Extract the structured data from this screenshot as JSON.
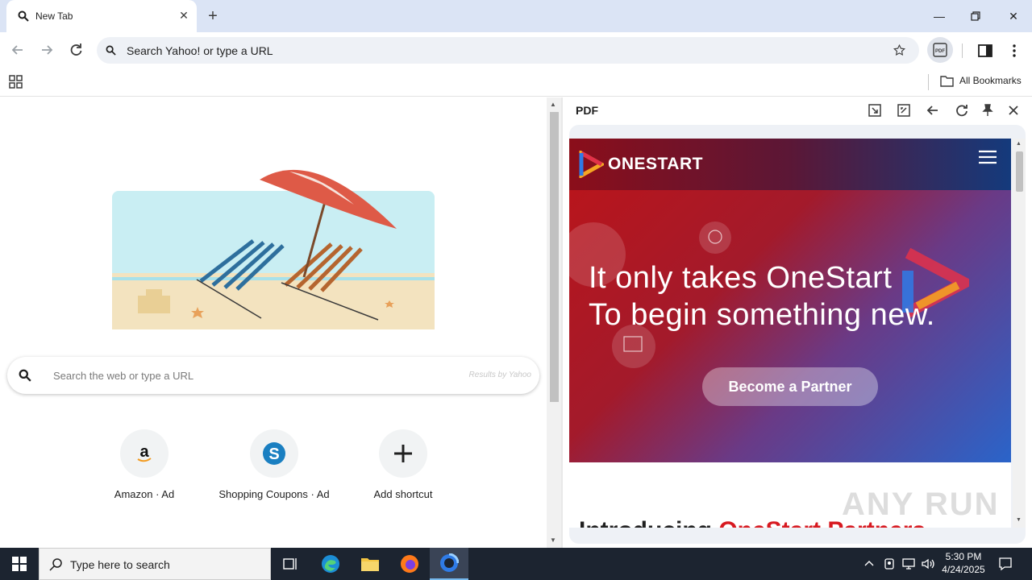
{
  "browser": {
    "tab_title": "New Tab",
    "omnibox_placeholder": "Search Yahoo! or type a URL",
    "bookmarks_all": "All Bookmarks"
  },
  "newtab": {
    "search_placeholder": "Search the web or type a URL",
    "search_provider": "Results by Yahoo",
    "shortcuts": [
      {
        "label": "Amazon · Ad",
        "icon": "amazon-icon"
      },
      {
        "label": "Shopping Coupons · Ad",
        "icon": "shopping-coupons-icon"
      },
      {
        "label": "Add shortcut",
        "icon": "plus-icon"
      }
    ]
  },
  "side_panel": {
    "title": "PDF",
    "site": {
      "brand": "ONESTART",
      "headline_1": "It only takes OneStart",
      "headline_2": "To begin something new.",
      "cta": "Become a Partner",
      "intro_start": "Introducing ",
      "intro_red": "OneStart Partners"
    }
  },
  "watermark": "ANY RUN",
  "taskbar": {
    "search_placeholder": "Type here to search",
    "time": "5:30 PM",
    "date": "4/24/2025"
  },
  "colors": {
    "tabstrip": "#dbe4f5",
    "omnibox": "#eef1f6",
    "onestart_red": "#d71920",
    "taskbar": "#1c2430"
  }
}
